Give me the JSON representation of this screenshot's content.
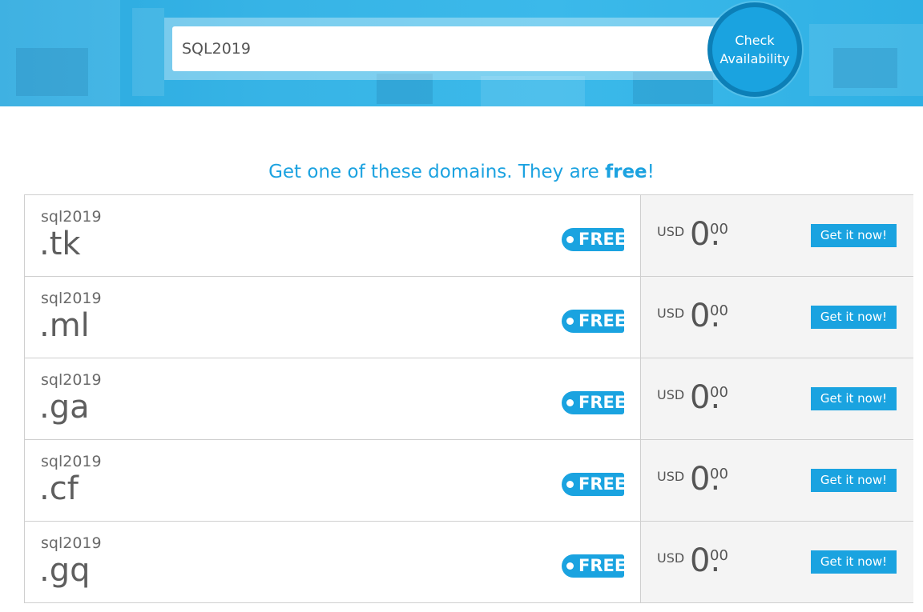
{
  "search": {
    "value": "SQL2019",
    "button_label_line1": "Check",
    "button_label_line2": "Availability"
  },
  "headline": {
    "prefix": "Get one of these domains. They are ",
    "emphasis": "free",
    "suffix": "!"
  },
  "domains": [
    {
      "name": "sql2019",
      "tld": ".tk",
      "badge": "FREE",
      "currency": "USD",
      "price_whole": "0.",
      "price_cents": "00",
      "action": "Get it now!"
    },
    {
      "name": "sql2019",
      "tld": ".ml",
      "badge": "FREE",
      "currency": "USD",
      "price_whole": "0.",
      "price_cents": "00",
      "action": "Get it now!"
    },
    {
      "name": "sql2019",
      "tld": ".ga",
      "badge": "FREE",
      "currency": "USD",
      "price_whole": "0.",
      "price_cents": "00",
      "action": "Get it now!"
    },
    {
      "name": "sql2019",
      "tld": ".cf",
      "badge": "FREE",
      "currency": "USD",
      "price_whole": "0.",
      "price_cents": "00",
      "action": "Get it now!"
    },
    {
      "name": "sql2019",
      "tld": ".gq",
      "badge": "FREE",
      "currency": "USD",
      "price_whole": "0.",
      "price_cents": "00",
      "action": "Get it now!"
    }
  ],
  "colors": {
    "accent": "#1aa3e0",
    "accent_dark": "#0c7fb7",
    "price_panel": "#f4f4f4"
  }
}
